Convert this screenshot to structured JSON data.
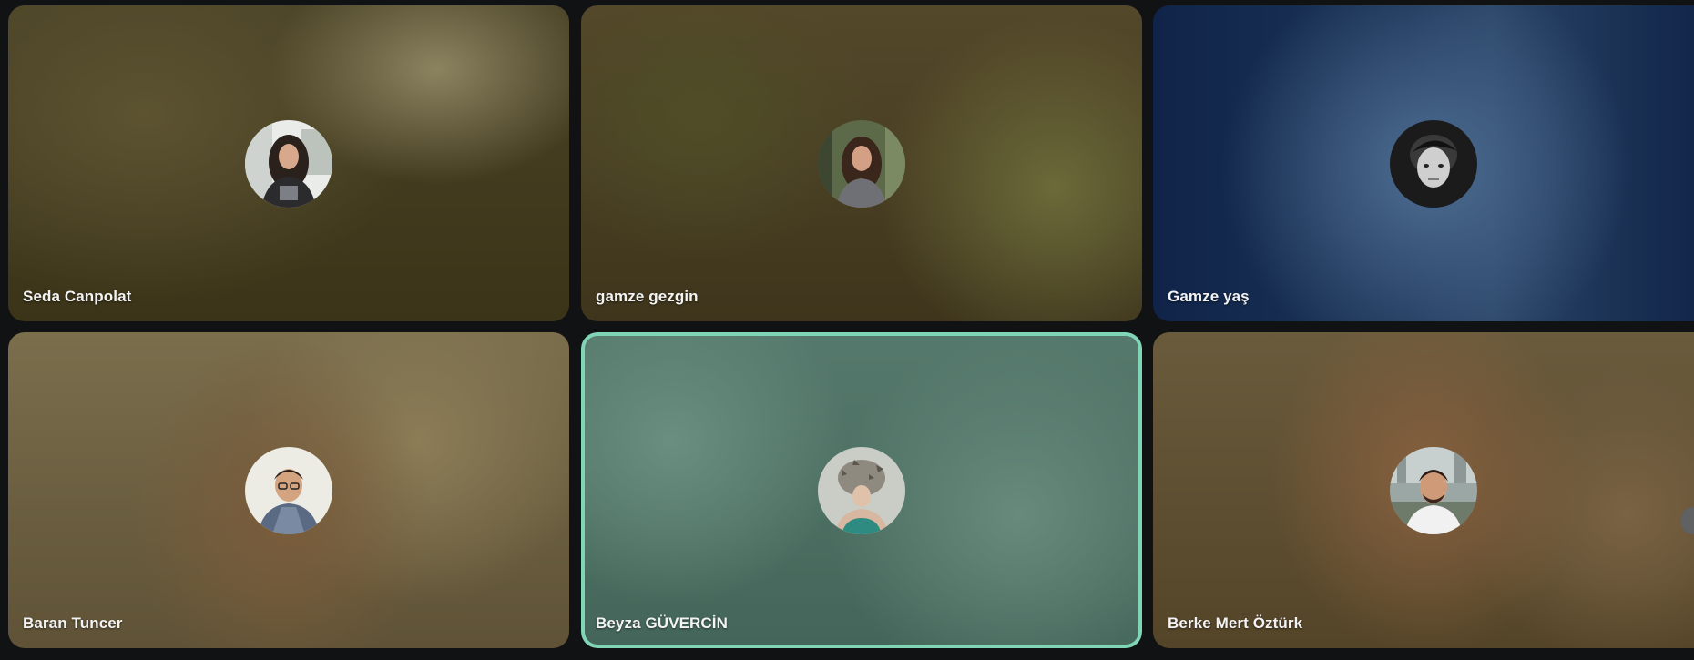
{
  "participants": [
    {
      "name": "Seda Canpolat",
      "bg": "#4a4125"
    },
    {
      "name": "gamze gezgin",
      "bg": "#55502a"
    },
    {
      "name": "Gamze yaş",
      "bg": "#1f3456"
    },
    {
      "name": "Baran Tuncer",
      "bg": "#6e6243"
    },
    {
      "name": "Beyza GÜVERCİN",
      "bg": "#51796b",
      "speaking": true,
      "highlight": "#7fd5b5"
    },
    {
      "name": "Berke Mert Öztürk",
      "bg": "#6b5a3e"
    }
  ],
  "icons": {
    "overflow_tab": "side-panel-handle-icon"
  }
}
